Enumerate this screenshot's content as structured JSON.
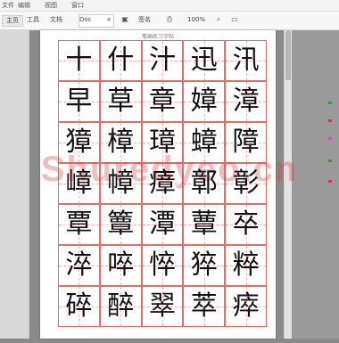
{
  "menu": [
    "文件",
    "编辑",
    "视图",
    "窗口"
  ],
  "toolbar": {
    "home": "主页",
    "tools": "工具",
    "document_tab": "Doc",
    "doc_label": "文档",
    "tools2": "签名",
    "zoom": "100%"
  },
  "page": {
    "title": "笔画练习字帖"
  },
  "worksheet": {
    "rows": [
      [
        "十",
        "什",
        "汁",
        "迅",
        "汛"
      ],
      [
        "早",
        "草",
        "章",
        "嫜",
        "漳"
      ],
      [
        "獐",
        "樟",
        "璋",
        "蟑",
        "障"
      ],
      [
        "嶂",
        "幛",
        "瘴",
        "鄣",
        "彰"
      ],
      [
        "覃",
        "簟",
        "潭",
        "蕈",
        "卒"
      ],
      [
        "淬",
        "啐",
        "悴",
        "猝",
        "粹"
      ],
      [
        "碎",
        "醉",
        "翠",
        "萃",
        "瘁"
      ]
    ]
  },
  "watermark": "Shuredyeo.cn",
  "colors": {
    "grid_line": "#e46c6c",
    "grid_guide": "#f2b8b8",
    "watermark": "#d64646"
  }
}
